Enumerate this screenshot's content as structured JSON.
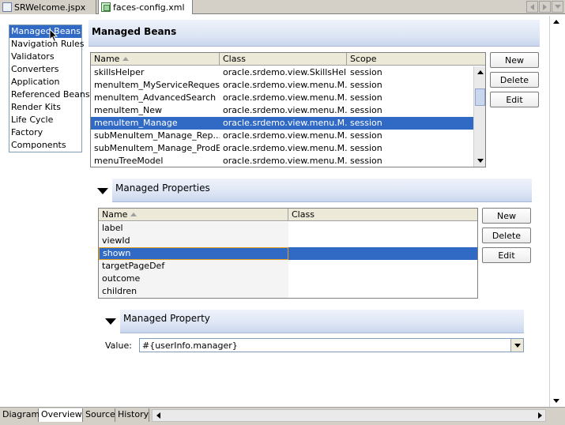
{
  "editor_tabs": [
    {
      "label": "SRWelcome.jspx",
      "icon": "jspx-file-icon",
      "active": false
    },
    {
      "label": "faces-config.xml",
      "icon": "xml-file-icon",
      "active": true
    }
  ],
  "categories": [
    {
      "label": "Managed Beans",
      "selected": true
    },
    {
      "label": "Navigation Rules",
      "selected": false
    },
    {
      "label": "Validators",
      "selected": false
    },
    {
      "label": "Converters",
      "selected": false
    },
    {
      "label": "Application",
      "selected": false
    },
    {
      "label": "Referenced Beans",
      "selected": false
    },
    {
      "label": "Render Kits",
      "selected": false
    },
    {
      "label": "Life Cycle",
      "selected": false
    },
    {
      "label": "Factory",
      "selected": false
    },
    {
      "label": "Components",
      "selected": false
    }
  ],
  "managed_beans": {
    "title": "Managed Beans",
    "columns": [
      "Name",
      "Class",
      "Scope"
    ],
    "rows": [
      {
        "name": "skillsHelper",
        "class": "oracle.srdemo.view.SkillsHelper",
        "scope": "session",
        "selected": false
      },
      {
        "name": "menuItem_MyServiceRequests",
        "class": "oracle.srdemo.view.menu.M...",
        "scope": "session",
        "selected": false
      },
      {
        "name": "menuItem_AdvancedSearch",
        "class": "oracle.srdemo.view.menu.M...",
        "scope": "session",
        "selected": false
      },
      {
        "name": "menuItem_New",
        "class": "oracle.srdemo.view.menu.M...",
        "scope": "session",
        "selected": false
      },
      {
        "name": "menuItem_Manage",
        "class": "oracle.srdemo.view.menu.M...",
        "scope": "session",
        "selected": true
      },
      {
        "name": "subMenuItem_Manage_Rep...",
        "class": "oracle.srdemo.view.menu.M...",
        "scope": "session",
        "selected": false
      },
      {
        "name": "subMenuItem_Manage_ProdEx",
        "class": "oracle.srdemo.view.menu.M...",
        "scope": "session",
        "selected": false
      },
      {
        "name": "menuTreeModel",
        "class": "oracle.srdemo.view.menu.M...",
        "scope": "session",
        "selected": false
      }
    ],
    "buttons": {
      "new": "New",
      "delete": "Delete",
      "edit": "Edit"
    }
  },
  "managed_properties": {
    "title": "Managed Properties",
    "columns": [
      "Name",
      "Class"
    ],
    "rows": [
      {
        "name": "label",
        "class": "",
        "selected": false
      },
      {
        "name": "viewId",
        "class": "",
        "selected": false
      },
      {
        "name": "shown",
        "class": "",
        "selected": true
      },
      {
        "name": "targetPageDef",
        "class": "",
        "selected": false
      },
      {
        "name": "outcome",
        "class": "",
        "selected": false
      },
      {
        "name": "children",
        "class": "",
        "selected": false
      }
    ],
    "buttons": {
      "new": "New",
      "delete": "Delete",
      "edit": "Edit"
    }
  },
  "managed_property": {
    "title": "Managed Property",
    "value_label": "Value:",
    "value": "#{userInfo.manager}"
  },
  "bottom_tabs": [
    {
      "label": "Diagram",
      "active": false
    },
    {
      "label": "Overview",
      "active": true
    },
    {
      "label": "Source",
      "active": false
    },
    {
      "label": "History",
      "active": false
    }
  ],
  "colors": {
    "selection": "#316ac5",
    "banner": "#dde6f5",
    "edit_border": "#e5a020"
  }
}
